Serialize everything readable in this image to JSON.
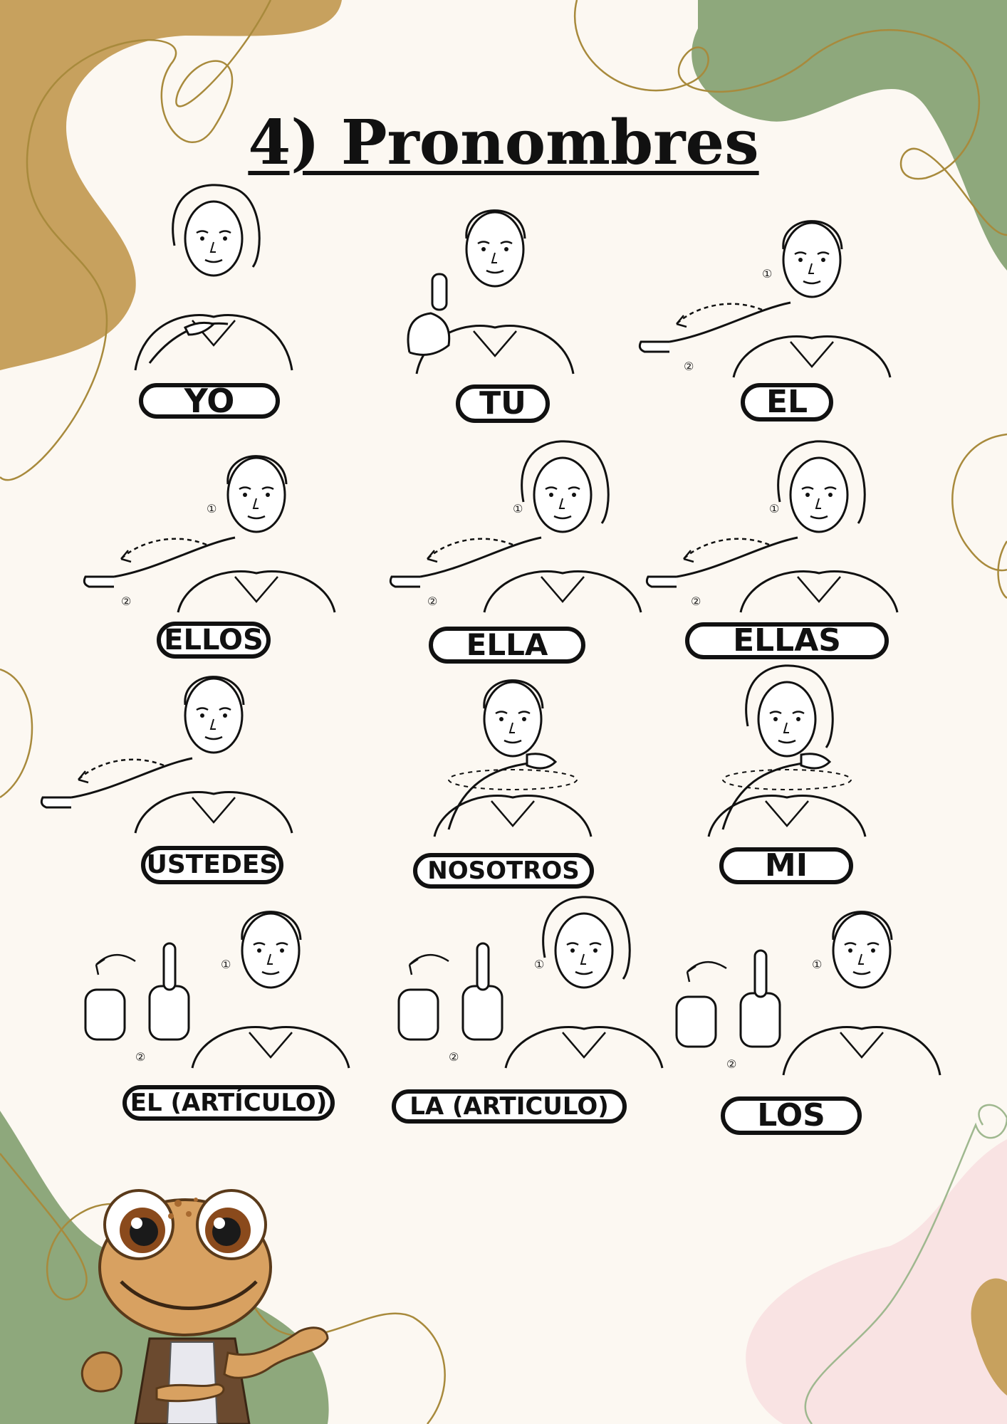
{
  "title": "4) Pronombres",
  "colors": {
    "background": "#fcf8f2",
    "mustard": "#c7a15e",
    "sage": "#8ea87c",
    "pink": "#f9e3e3",
    "line": "#a88a3c",
    "ink": "#111111"
  },
  "signs": [
    {
      "label": "YO"
    },
    {
      "label": "TÚ"
    },
    {
      "label": "ÉL"
    },
    {
      "label": "ELLOS"
    },
    {
      "label": "ELLA"
    },
    {
      "label": "ELLAS"
    },
    {
      "label": "USTEDES"
    },
    {
      "label": "NOSOTROS"
    },
    {
      "label": "MI"
    },
    {
      "label": "EL (ARTÍCULO)"
    },
    {
      "label": "LA (ARTICULO)"
    },
    {
      "label": "LOS"
    }
  ],
  "step_markers": [
    "①",
    "②"
  ],
  "mascot": {
    "icon": "gecko-mascot-icon"
  }
}
